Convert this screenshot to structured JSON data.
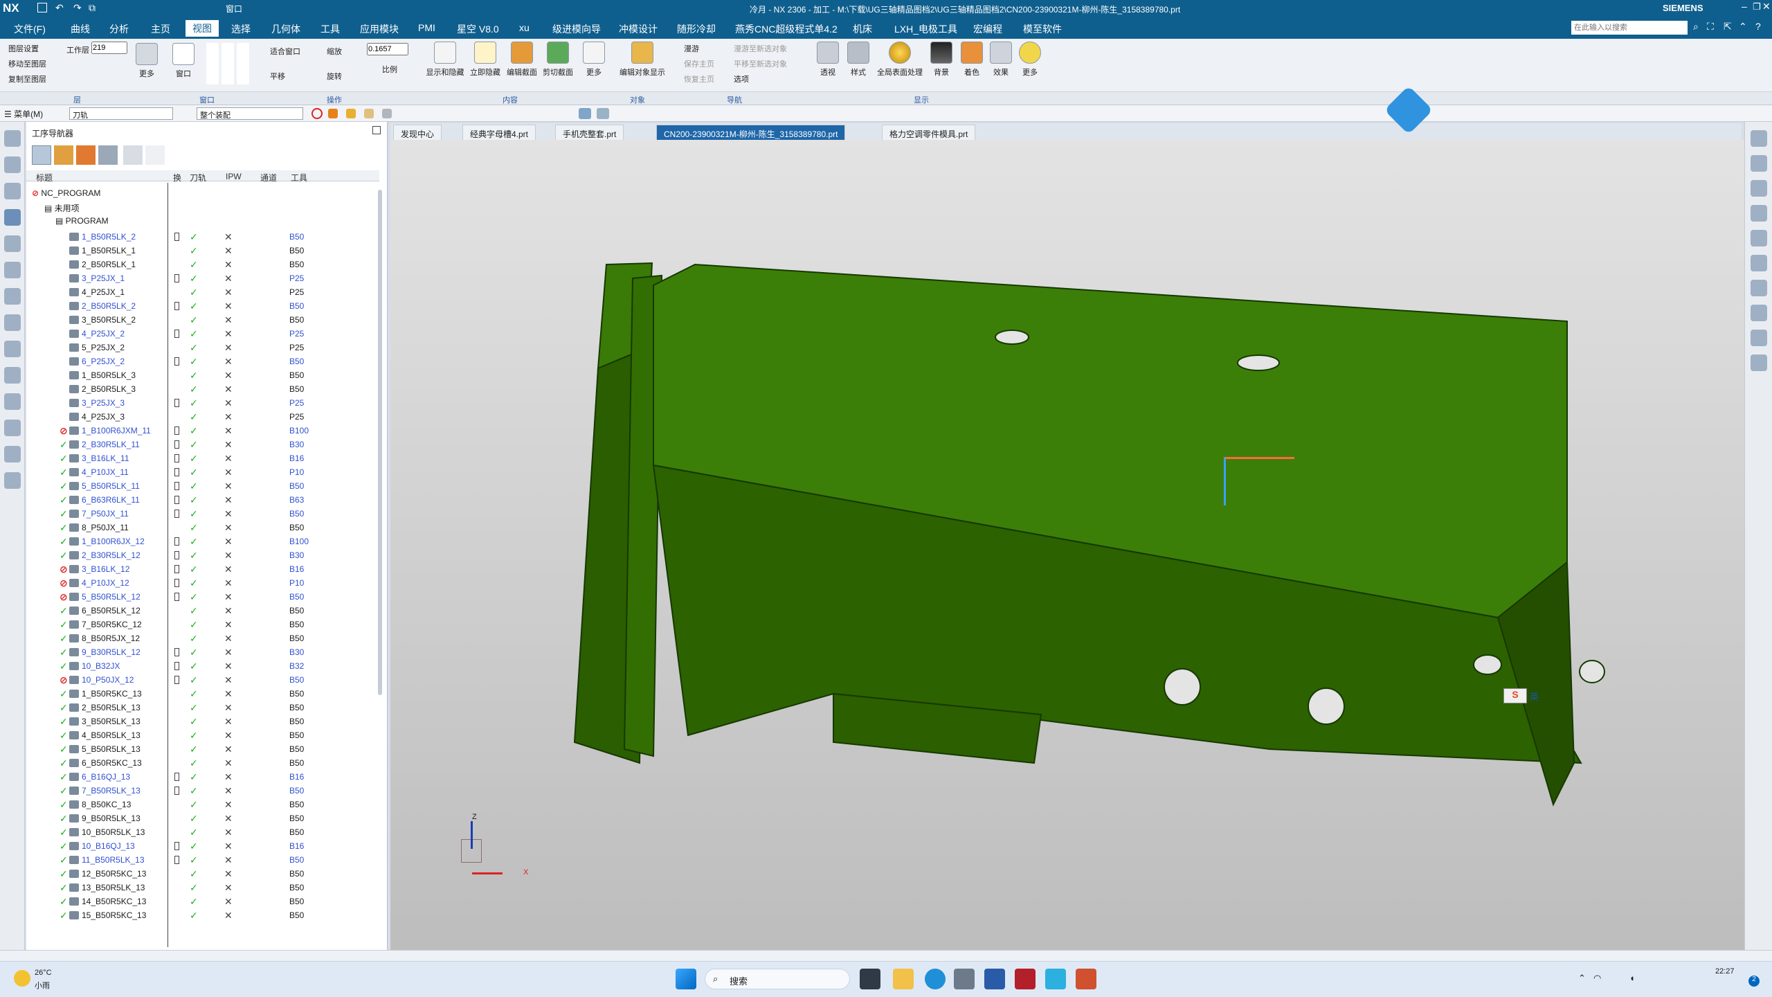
{
  "app": {
    "title": "冷月 - NX 2306 - 加工 - M:\\下载\\UG三轴精品图档2\\UG三轴精品图档2\\CN200-23900321M-柳州-陈生_3158389780.prt",
    "brand": "SIEMENS",
    "logo": "NX",
    "window_menu": "窗口"
  },
  "menubar": {
    "items": [
      "文件(F)",
      "曲线",
      "分析",
      "主页",
      "视图",
      "选择",
      "几何体",
      "工具",
      "应用模块",
      "PMI",
      "星空 V8.0",
      "xu",
      "级进模向导",
      "冲模设计",
      "随形冷却",
      "燕秀CNC超级程式单4.2",
      "机床",
      "LXH_电极工具",
      "宏编程",
      "模至软件"
    ],
    "active": "视图",
    "search_placeholder": "在此输入以搜索"
  },
  "ribbon": {
    "layer_buttons": [
      "图层设置",
      "移动至图层",
      "复制至图层"
    ],
    "work_layer_label": "工作层",
    "work_layer_value": "219",
    "more": "更多",
    "window_label": "窗口",
    "fit_window": "适合窗口",
    "zoom": "缩放",
    "zoom_value": "0.1657",
    "pan": "平移",
    "rotate": "旋转",
    "scale": "比例",
    "content_buttons": [
      "显示和隐藏",
      "立即隐藏",
      "编辑截面",
      "剪切截面",
      "更多"
    ],
    "edit_object_display": "编辑对象显示",
    "nav_items": [
      "漫游",
      "保存主页",
      "恢复主页"
    ],
    "nav_items2": [
      "漫游至新选对象",
      "平移至新选对象",
      "选项"
    ],
    "display_buttons": [
      "透视",
      "样式",
      "全局表面处理",
      "背景",
      "着色",
      "效果",
      "更多"
    ],
    "groups": [
      "层",
      "窗口",
      "操作",
      "内容",
      "对象",
      "导航",
      "显示"
    ]
  },
  "selbar": {
    "menu": "菜单(M)",
    "filter1": "刀轨",
    "filter2": "整个装配"
  },
  "nav": {
    "title": "工序导航器",
    "columns": [
      "标题",
      "换",
      "刀轨",
      "IPW",
      "通道",
      "工具"
    ],
    "root": "NC_PROGRAM",
    "unused": "未用项",
    "program": "PROGRAM",
    "rows": [
      {
        "name": "1_B50R5LK_2",
        "tool": "B50",
        "style": "blue",
        "status": "none",
        "tag": true
      },
      {
        "name": "1_B50R5LK_1",
        "tool": "B50",
        "style": "black",
        "status": "none",
        "tag": false
      },
      {
        "name": "2_B50R5LK_1",
        "tool": "B50",
        "style": "black",
        "status": "none",
        "tag": false
      },
      {
        "name": "3_P25JX_1",
        "tool": "P25",
        "style": "blue",
        "status": "none",
        "tag": true
      },
      {
        "name": "4_P25JX_1",
        "tool": "P25",
        "style": "black",
        "status": "none",
        "tag": false
      },
      {
        "name": "2_B50R5LK_2",
        "tool": "B50",
        "style": "blue",
        "status": "none",
        "tag": true
      },
      {
        "name": "3_B50R5LK_2",
        "tool": "B50",
        "style": "black",
        "status": "none",
        "tag": false
      },
      {
        "name": "4_P25JX_2",
        "tool": "P25",
        "style": "blue",
        "status": "none",
        "tag": true
      },
      {
        "name": "5_P25JX_2",
        "tool": "P25",
        "style": "black",
        "status": "none",
        "tag": false
      },
      {
        "name": "6_P25JX_2",
        "tool": "B50",
        "style": "blue",
        "status": "none",
        "tag": true
      },
      {
        "name": "1_B50R5LK_3",
        "tool": "B50",
        "style": "black",
        "status": "none",
        "tag": false
      },
      {
        "name": "2_B50R5LK_3",
        "tool": "B50",
        "style": "black",
        "status": "none",
        "tag": false
      },
      {
        "name": "3_P25JX_3",
        "tool": "P25",
        "style": "blue",
        "status": "none",
        "tag": true
      },
      {
        "name": "4_P25JX_3",
        "tool": "P25",
        "style": "black",
        "status": "none",
        "tag": false
      },
      {
        "name": "1_B100R6JXM_11",
        "tool": "B100",
        "style": "blue",
        "status": "red",
        "tag": true
      },
      {
        "name": "2_B30R5LK_11",
        "tool": "B30",
        "style": "blue",
        "status": "green",
        "tag": true
      },
      {
        "name": "3_B16LK_11",
        "tool": "B16",
        "style": "blue",
        "status": "green",
        "tag": true
      },
      {
        "name": "4_P10JX_11",
        "tool": "P10",
        "style": "blue",
        "status": "green",
        "tag": true
      },
      {
        "name": "5_B50R5LK_11",
        "tool": "B50",
        "style": "blue",
        "status": "green",
        "tag": true
      },
      {
        "name": "6_B63R6LK_11",
        "tool": "B63",
        "style": "blue",
        "status": "green",
        "tag": true
      },
      {
        "name": "7_P50JX_11",
        "tool": "B50",
        "style": "blue",
        "status": "green",
        "tag": true
      },
      {
        "name": "8_P50JX_11",
        "tool": "B50",
        "style": "black",
        "status": "green",
        "tag": false
      },
      {
        "name": "1_B100R6JX_12",
        "tool": "B100",
        "style": "blue",
        "status": "green",
        "tag": true
      },
      {
        "name": "2_B30R5LK_12",
        "tool": "B30",
        "style": "blue",
        "status": "green",
        "tag": true
      },
      {
        "name": "3_B16LK_12",
        "tool": "B16",
        "style": "blue",
        "status": "red",
        "tag": true
      },
      {
        "name": "4_P10JX_12",
        "tool": "P10",
        "style": "blue",
        "status": "red",
        "tag": true
      },
      {
        "name": "5_B50R5LK_12",
        "tool": "B50",
        "style": "blue",
        "status": "red",
        "tag": true
      },
      {
        "name": "6_B50R5LK_12",
        "tool": "B50",
        "style": "black",
        "status": "green",
        "tag": false
      },
      {
        "name": "7_B50R5KC_12",
        "tool": "B50",
        "style": "black",
        "status": "green",
        "tag": false
      },
      {
        "name": "8_B50R5JX_12",
        "tool": "B50",
        "style": "black",
        "status": "green",
        "tag": false
      },
      {
        "name": "9_B30R5LK_12",
        "tool": "B30",
        "style": "blue",
        "status": "green",
        "tag": true
      },
      {
        "name": "10_B32JX",
        "tool": "B32",
        "style": "blue",
        "status": "green",
        "tag": true
      },
      {
        "name": "10_P50JX_12",
        "tool": "B50",
        "style": "blue",
        "status": "red",
        "tag": true
      },
      {
        "name": "1_B50R5KC_13",
        "tool": "B50",
        "style": "black",
        "status": "green",
        "tag": false
      },
      {
        "name": "2_B50R5LK_13",
        "tool": "B50",
        "style": "black",
        "status": "green",
        "tag": false
      },
      {
        "name": "3_B50R5LK_13",
        "tool": "B50",
        "style": "black",
        "status": "green",
        "tag": false
      },
      {
        "name": "4_B50R5LK_13",
        "tool": "B50",
        "style": "black",
        "status": "green",
        "tag": false
      },
      {
        "name": "5_B50R5LK_13",
        "tool": "B50",
        "style": "black",
        "status": "green",
        "tag": false
      },
      {
        "name": "6_B50R5KC_13",
        "tool": "B50",
        "style": "black",
        "status": "green",
        "tag": false
      },
      {
        "name": "6_B16QJ_13",
        "tool": "B16",
        "style": "blue",
        "status": "green",
        "tag": true
      },
      {
        "name": "7_B50R5LK_13",
        "tool": "B50",
        "style": "blue",
        "status": "green",
        "tag": true
      },
      {
        "name": "8_B50KC_13",
        "tool": "B50",
        "style": "black",
        "status": "green",
        "tag": false
      },
      {
        "name": "9_B50R5LK_13",
        "tool": "B50",
        "style": "black",
        "status": "green",
        "tag": false
      },
      {
        "name": "10_B50R5LK_13",
        "tool": "B50",
        "style": "black",
        "status": "green",
        "tag": false
      },
      {
        "name": "10_B16QJ_13",
        "tool": "B16",
        "style": "blue",
        "status": "green",
        "tag": true
      },
      {
        "name": "11_B50R5LK_13",
        "tool": "B50",
        "style": "blue",
        "status": "green",
        "tag": true
      },
      {
        "name": "12_B50R5KC_13",
        "tool": "B50",
        "style": "black",
        "status": "green",
        "tag": false
      },
      {
        "name": "13_B50R5LK_13",
        "tool": "B50",
        "style": "black",
        "status": "green",
        "tag": false
      },
      {
        "name": "14_B50R5KC_13",
        "tool": "B50",
        "style": "black",
        "status": "green",
        "tag": false
      },
      {
        "name": "15_B50R5KC_13",
        "tool": "B50",
        "style": "black",
        "status": "green",
        "tag": false
      }
    ]
  },
  "tabs": [
    {
      "label": "发现中心",
      "active": false
    },
    {
      "label": "经典字母槽4.prt",
      "active": false
    },
    {
      "label": "手机壳整套.prt",
      "active": false
    },
    {
      "label": "CN200-23900321M-柳州-陈生_3158389780.prt",
      "active": true
    },
    {
      "label": "格力空调零件模具.prt",
      "active": false
    }
  ],
  "viewport": {
    "model_color": "#2f6b00",
    "model_edge": "#163800",
    "axis_x": "X",
    "axis_z": "Z"
  },
  "ime": {
    "label": "英"
  },
  "taskbar": {
    "weather_temp": "26°C",
    "weather_desc": "小雨",
    "search": "搜索",
    "time": "22:27",
    "notify": "2"
  }
}
